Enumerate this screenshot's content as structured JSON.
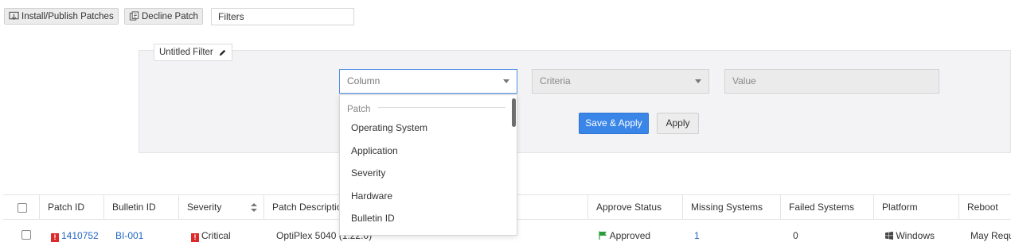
{
  "toolbar": {
    "install_publish_label": "Install/Publish Patches",
    "decline_label": "Decline Patch",
    "filters_label": "Filters"
  },
  "filter_panel": {
    "tab_name": "Untitled Filter",
    "column_placeholder": "Column",
    "criteria_placeholder": "Criteria",
    "value_placeholder": "Value",
    "save_apply_label": "Save & Apply",
    "apply_label": "Apply"
  },
  "column_dropdown": {
    "group_label": "Patch",
    "items": [
      "Operating System",
      "Application",
      "Severity",
      "Hardware",
      "Bulletin ID"
    ]
  },
  "table": {
    "headers": {
      "patch_id": "Patch ID",
      "bulletin_id": "Bulletin ID",
      "severity": "Severity",
      "patch_description": "Patch Descriptio",
      "approve_status": "Approve Status",
      "missing_systems": "Missing Systems",
      "failed_systems": "Failed Systems",
      "platform": "Platform",
      "reboot": "Reboot"
    },
    "rows": [
      {
        "patch_id": "1410752",
        "bulletin_id": "BI-001",
        "severity": "Critical",
        "patch_description": "OptiPlex 5040 (1.22.0)",
        "approve_status": "Approved",
        "missing_systems": "1",
        "failed_systems": "0",
        "platform": "Windows",
        "reboot": "May Requ"
      }
    ]
  },
  "colors": {
    "primary": "#3a86e8",
    "link": "#2466c4",
    "critical": "#d92b2b",
    "approved": "#2a9d3a"
  }
}
